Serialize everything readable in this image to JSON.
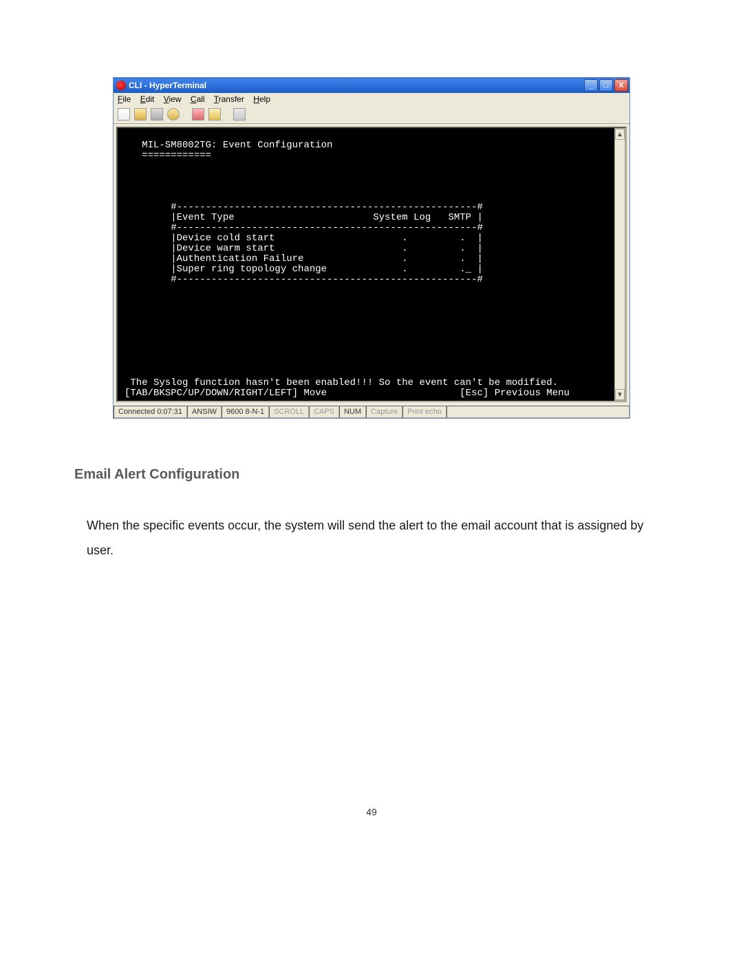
{
  "window": {
    "title": "CLI - HyperTerminal",
    "btn_min": "_",
    "btn_max": "□",
    "btn_close": "X"
  },
  "menu": {
    "file": "File",
    "edit": "Edit",
    "view": "View",
    "call": "Call",
    "transfer": "Transfer",
    "help": "Help"
  },
  "terminal": {
    "header": "   MIL-SM8002TG: Event Configuration",
    "underline": "   ============",
    "table_top": "        #----------------------------------------------------#",
    "table_hdr": "        |Event Type                        System Log   SMTP |",
    "table_sep": "        #----------------------------------------------------#",
    "row1": "        |Device cold start                      .         .  |",
    "row2": "        |Device warm start                      .         .  |",
    "row3": "        |Authentication Failure                 .         .  |",
    "row4": "        |Super ring topology change             .         ._ |",
    "table_bot": "        #----------------------------------------------------#",
    "warn": " The Syslog function hasn't been enabled!!! So the event can't be modified.",
    "nav": "[TAB/BKSPC/UP/DOWN/RIGHT/LEFT] Move                       [Esc] Previous Menu"
  },
  "status": {
    "connected": "Connected 0:07:31",
    "emu": "ANSIW",
    "baud": "9600 8-N-1",
    "scroll": "SCROLL",
    "caps": "CAPS",
    "num": "NUM",
    "capture": "Capture",
    "echo": "Print echo"
  },
  "doc": {
    "heading": "Email Alert Configuration",
    "paragraph": "When the specific events occur, the system will send the alert to the email account that is assigned by user.",
    "pagenum": "49"
  }
}
